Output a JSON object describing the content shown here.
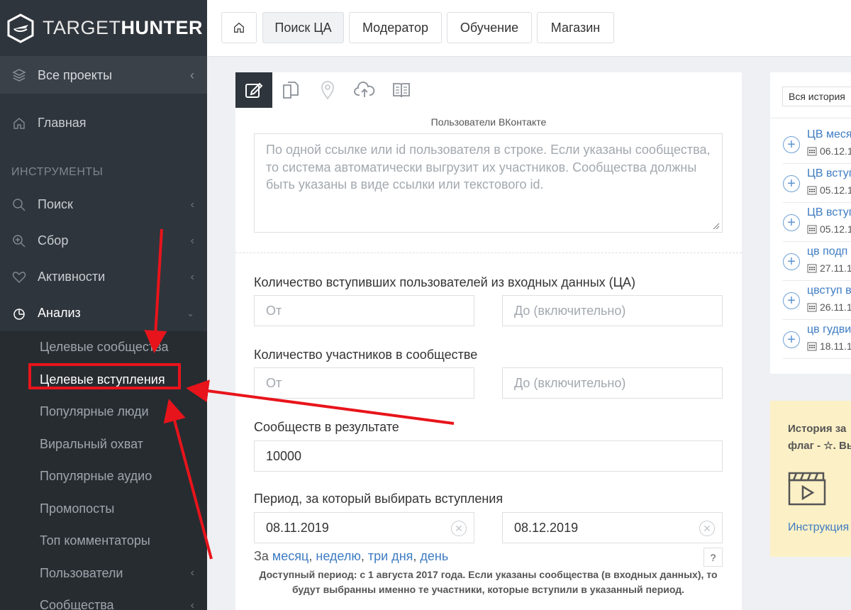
{
  "app": {
    "logo_light": "TARGET",
    "logo_bold": "HUNTER"
  },
  "sidebar": {
    "projects_label": "Все проекты",
    "home_label": "Главная",
    "section_title": "ИНСТРУМЕНТЫ",
    "items": [
      {
        "label": "Поиск",
        "icon": "search-icon"
      },
      {
        "label": "Сбор",
        "icon": "zoom-plus-icon"
      },
      {
        "label": "Активности",
        "icon": "heart-icon"
      },
      {
        "label": "Анализ",
        "icon": "pie-chart-icon"
      }
    ],
    "submenu": [
      "Целевые сообщества",
      "Целевые вступления",
      "Популярные люди",
      "Виральный охват",
      "Популярные аудио",
      "Промопосты",
      "Топ комментаторы",
      "Пользователи",
      "Сообщества"
    ],
    "selected_submenu": "Целевые вступления"
  },
  "topbar": {
    "tabs": [
      "Поиск ЦА",
      "Модератор",
      "Обучение",
      "Магазин"
    ],
    "active_tab": "Поиск ЦА"
  },
  "form": {
    "caption": "Пользователи ВКонтакте",
    "users_placeholder": "По одной ссылке или id пользователя в строке. Если указаны сообщества, то система автоматически выгрузит их участников. Сообщества должны быть указаны в виде ссылки или текстового id.",
    "joined_label": "Количество вступивших пользователей из входных данных (ЦА)",
    "members_label": "Количество участников в сообществе",
    "from_placeholder": "От",
    "to_placeholder": "До (включительно)",
    "result_label": "Сообществ в результате",
    "result_value": "10000",
    "period_label": "Период, за который выбирать вступления",
    "date_from": "08.11.2019",
    "date_to": "08.12.2019",
    "quick_prefix": "За",
    "quick_links": [
      "месяц",
      "неделю",
      "три дня",
      "день"
    ],
    "help_label": "?",
    "note": "Доступный период: с 1 августа 2017 года. Если указаны сообщества (в входных данных), то будут выбранны именно те участники, которые вступили в указанный период."
  },
  "history": {
    "select_label": "Вся история",
    "items": [
      {
        "title": "ЦВ меся",
        "date": "06.12.1"
      },
      {
        "title": "ЦВ вступ",
        "date": "05.12.1"
      },
      {
        "title": "ЦВ вступ",
        "date": "05.12.1"
      },
      {
        "title": "цв подп",
        "date": "27.11.1"
      },
      {
        "title": "цвступ в",
        "date": "26.11.1"
      },
      {
        "title": "цв гудви",
        "date": "18.11.1"
      }
    ]
  },
  "tip": {
    "line1": "История за",
    "line2": "флаг - ☆. Вы",
    "link": "Инструкция"
  },
  "colors": {
    "sidebar_bg": "#2f353c",
    "accent_link": "#3e7cc2",
    "annotation_red": "#e8141b",
    "tip_bg": "#fcf0c6"
  }
}
